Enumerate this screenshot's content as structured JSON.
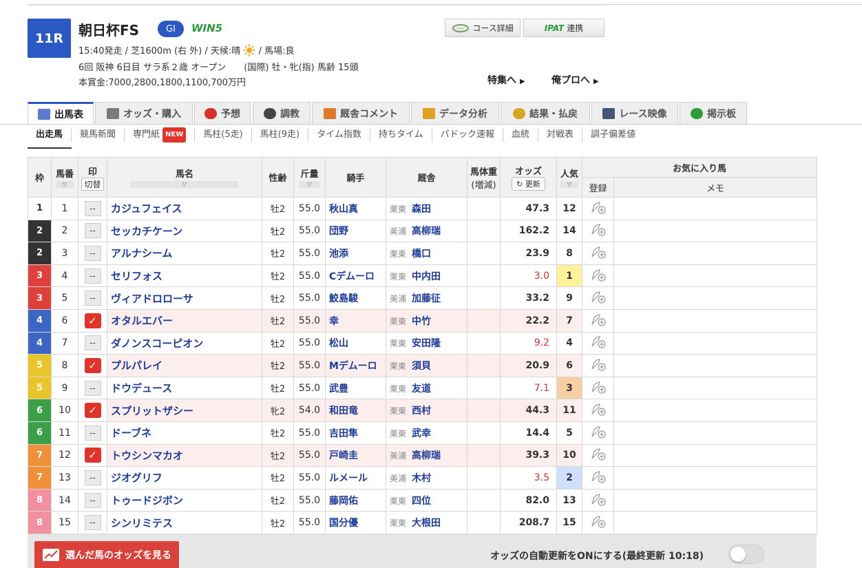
{
  "race": {
    "number": "11R",
    "name": "朝日杯FS",
    "grade": "GI",
    "win5": "WIN5",
    "line1_a": "15:40発走 / 芝1600m (右 外) / 天候:晴",
    "line1_b": "/ 馬場:良",
    "line2": "6回 阪神 6日目 サラ系２歳 オープン　　(国際) 牡・牝(指) 馬齢 15頭",
    "line3": "本賞金:7000,2800,1800,1100,700万円"
  },
  "header_buttons": {
    "course": "コース詳細",
    "ipat_logo": "IPAT",
    "ipat_label": "連携"
  },
  "links": {
    "tokushu": "特集へ",
    "orepro": "俺プロへ"
  },
  "tabs": [
    {
      "label": "出馬表",
      "icon": "table-icon",
      "color": "#5a7bd0"
    },
    {
      "label": "オッズ・購入",
      "icon": "odds-icon",
      "color": "#7a7a7a"
    },
    {
      "label": "予想",
      "icon": "target-icon",
      "color": "#d9312a"
    },
    {
      "label": "調教",
      "icon": "stopwatch-icon",
      "color": "#444444"
    },
    {
      "label": "厩舎コメント",
      "icon": "stable-icon",
      "color": "#e07a2a"
    },
    {
      "label": "データ分析",
      "icon": "bar-chart-icon",
      "color": "#e0a020"
    },
    {
      "label": "結果・払戻",
      "icon": "coins-icon",
      "color": "#d9a520"
    },
    {
      "label": "レース映像",
      "icon": "video-icon",
      "color": "#445577"
    },
    {
      "label": "掲示板",
      "icon": "chat-icon",
      "color": "#2a9c3a"
    }
  ],
  "subtabs": [
    "出走馬",
    "競馬新聞",
    "専門紙",
    "馬柱(5走)",
    "馬柱(9走)",
    "タイム指数",
    "持ちタイム",
    "パドック速報",
    "血統",
    "対戦表",
    "調子偏差値"
  ],
  "new_badge": "NEW",
  "table_headers": {
    "waku": "枠",
    "umaban": "馬番",
    "mark": "印",
    "mark_switch": "切替",
    "name": "馬名",
    "sex_age": "性齢",
    "weight": "斤量",
    "jockey": "騎手",
    "trainer": "厩舎",
    "body_weight": "馬体重",
    "body_weight_diff": "(増減)",
    "odds": "オッズ",
    "refresh": "更新",
    "popularity": "人気",
    "favorite": "お気に入り馬",
    "register": "登録",
    "memo": "メモ"
  },
  "waku_colors": {
    "1": {
      "bg": "#ffffff",
      "fg": "#333333"
    },
    "2": {
      "bg": "#333333",
      "fg": "#ffffff"
    },
    "3": {
      "bg": "#e0403a",
      "fg": "#ffffff"
    },
    "4": {
      "bg": "#3c66c4",
      "fg": "#ffffff"
    },
    "5": {
      "bg": "#e9c52a",
      "fg": "#ffffff"
    },
    "6": {
      "bg": "#3aa048",
      "fg": "#ffffff"
    },
    "7": {
      "bg": "#f0913a",
      "fg": "#ffffff"
    },
    "8": {
      "bg": "#f28fa0",
      "fg": "#ffffff"
    }
  },
  "horses": [
    {
      "waku": "1",
      "num": "1",
      "mark": "--",
      "name": "カジュフェイス",
      "sex": "牡2",
      "weight": "55.0",
      "jockey": "秋山真",
      "loc": "栗東",
      "trainer": "森田",
      "odds": "47.3",
      "hot": false,
      "pop": "12"
    },
    {
      "waku": "2",
      "num": "2",
      "mark": "--",
      "name": "セッカチケーン",
      "sex": "牡2",
      "weight": "55.0",
      "jockey": "団野",
      "loc": "美浦",
      "trainer": "高柳瑞",
      "odds": "162.2",
      "hot": false,
      "pop": "14"
    },
    {
      "waku": "2",
      "num": "3",
      "mark": "--",
      "name": "アルナシーム",
      "sex": "牡2",
      "weight": "55.0",
      "jockey": "池添",
      "loc": "栗東",
      "trainer": "橋口",
      "odds": "23.9",
      "hot": false,
      "pop": "8"
    },
    {
      "waku": "3",
      "num": "4",
      "mark": "--",
      "name": "セリフォス",
      "sex": "牡2",
      "weight": "55.0",
      "jockey": "Cデムーロ",
      "loc": "栗東",
      "trainer": "中内田",
      "odds": "3.0",
      "hot": true,
      "pop": "1"
    },
    {
      "waku": "3",
      "num": "5",
      "mark": "--",
      "name": "ヴィアドロローサ",
      "sex": "牡2",
      "weight": "55.0",
      "jockey": "鮫島駿",
      "loc": "美浦",
      "trainer": "加藤征",
      "odds": "33.2",
      "hot": false,
      "pop": "9"
    },
    {
      "waku": "4",
      "num": "6",
      "mark": "check",
      "name": "オタルエバー",
      "sex": "牡2",
      "weight": "55.0",
      "jockey": "幸",
      "loc": "栗東",
      "trainer": "中竹",
      "odds": "22.2",
      "hot": false,
      "pop": "7"
    },
    {
      "waku": "4",
      "num": "7",
      "mark": "--",
      "name": "ダノンスコーピオン",
      "sex": "牡2",
      "weight": "55.0",
      "jockey": "松山",
      "loc": "栗東",
      "trainer": "安田隆",
      "odds": "9.2",
      "hot": true,
      "pop": "4"
    },
    {
      "waku": "5",
      "num": "8",
      "mark": "check",
      "name": "プルパレイ",
      "sex": "牡2",
      "weight": "55.0",
      "jockey": "Mデムーロ",
      "loc": "栗東",
      "trainer": "須貝",
      "odds": "20.9",
      "hot": false,
      "pop": "6"
    },
    {
      "waku": "5",
      "num": "9",
      "mark": "--",
      "name": "ドウデュース",
      "sex": "牡2",
      "weight": "55.0",
      "jockey": "武豊",
      "loc": "栗東",
      "trainer": "友道",
      "odds": "7.1",
      "hot": true,
      "pop": "3"
    },
    {
      "waku": "6",
      "num": "10",
      "mark": "check",
      "name": "スプリットザシー",
      "sex": "牝2",
      "weight": "54.0",
      "jockey": "和田竜",
      "loc": "栗東",
      "trainer": "西村",
      "odds": "44.3",
      "hot": false,
      "pop": "11"
    },
    {
      "waku": "6",
      "num": "11",
      "mark": "--",
      "name": "ドーブネ",
      "sex": "牡2",
      "weight": "55.0",
      "jockey": "吉田隼",
      "loc": "栗東",
      "trainer": "武幸",
      "odds": "14.4",
      "hot": false,
      "pop": "5"
    },
    {
      "waku": "7",
      "num": "12",
      "mark": "check",
      "name": "トウシンマカオ",
      "sex": "牡2",
      "weight": "55.0",
      "jockey": "戸崎圭",
      "loc": "美浦",
      "trainer": "高柳瑞",
      "odds": "39.3",
      "hot": false,
      "pop": "10"
    },
    {
      "waku": "7",
      "num": "13",
      "mark": "--",
      "name": "ジオグリフ",
      "sex": "牡2",
      "weight": "55.0",
      "jockey": "ルメール",
      "loc": "美浦",
      "trainer": "木村",
      "odds": "3.5",
      "hot": true,
      "pop": "2"
    },
    {
      "waku": "8",
      "num": "14",
      "mark": "--",
      "name": "トゥードジボン",
      "sex": "牡2",
      "weight": "55.0",
      "jockey": "藤岡佑",
      "loc": "栗東",
      "trainer": "四位",
      "odds": "82.0",
      "hot": false,
      "pop": "13"
    },
    {
      "waku": "8",
      "num": "15",
      "mark": "--",
      "name": "シンリミテス",
      "sex": "牡2",
      "weight": "55.0",
      "jockey": "国分優",
      "loc": "栗東",
      "trainer": "大根田",
      "odds": "208.7",
      "hot": false,
      "pop": "15"
    }
  ],
  "bottom": {
    "odds_button": "選んだ馬のオッズを見る",
    "auto_update": "オッズの自動更新をONにする(最終更新 10:18)"
  }
}
